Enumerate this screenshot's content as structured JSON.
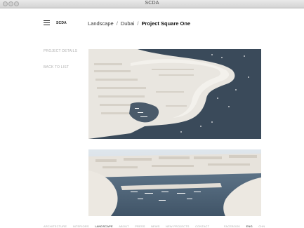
{
  "window": {
    "title": "SCDA"
  },
  "header": {
    "brand": "SCDA",
    "breadcrumb": [
      "Landscape",
      "Dubai",
      "Project Square One"
    ],
    "separator": "/"
  },
  "subnav": {
    "project_details": "PROJECT DETAILS",
    "back_to_list": "BACK TO LIST"
  },
  "footer": {
    "nav": [
      {
        "label": "ARCHITECTURE",
        "active": false
      },
      {
        "label": "INTERIORS",
        "active": false
      },
      {
        "label": "LANDSCAPE",
        "active": true
      },
      {
        "label": "ABOUT",
        "active": false
      },
      {
        "label": "PRESS",
        "active": false
      },
      {
        "label": "NEWS",
        "active": false
      },
      {
        "label": "NEW PROJECTS",
        "active": false
      },
      {
        "label": "CONTACT",
        "active": false
      }
    ],
    "right": [
      {
        "label": "FACEBOOK",
        "active": false
      },
      {
        "label": "ENG",
        "active": true
      },
      {
        "label": "CHN",
        "active": false
      }
    ]
  },
  "images": [
    {
      "name": "aerial-island-render"
    },
    {
      "name": "marina-perspective-render"
    }
  ],
  "colors": {
    "water": "#3a4a59",
    "land": "#ece9e3",
    "text_muted": "#b0b0b0",
    "text_dark": "#222222"
  }
}
